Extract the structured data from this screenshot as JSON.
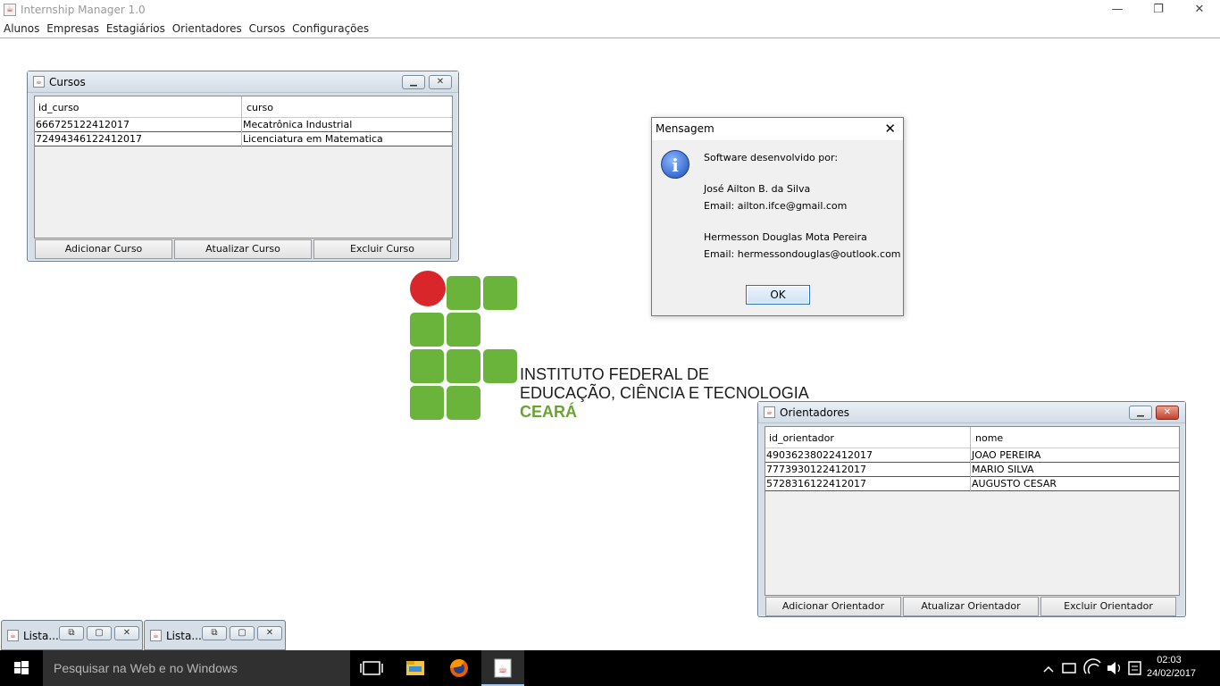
{
  "app": {
    "title": "Internship Manager 1.0"
  },
  "menu": [
    "Alunos",
    "Empresas",
    "Estagiários",
    "Orientadores",
    "Cursos",
    "Configurações"
  ],
  "cursos": {
    "title": "Cursos",
    "columns": [
      "id_curso",
      "curso"
    ],
    "rows": [
      [
        "666725122412017",
        "Mecatrônica Industrial"
      ],
      [
        "72494346122412017",
        "Licenciatura em Matematica"
      ]
    ],
    "buttons": [
      "Adicionar Curso",
      "Atualizar Curso",
      "Excluir Curso"
    ]
  },
  "orientadores": {
    "title": "Orientadores",
    "columns": [
      "id_orientador",
      "nome"
    ],
    "rows": [
      [
        "49036238022412017",
        "JOAO PEREIRA"
      ],
      [
        "7773930122412017",
        "MARIO SILVA"
      ],
      [
        "5728316122412017",
        "AUGUSTO CESAR"
      ]
    ],
    "buttons": [
      "Adicionar Orientador",
      "Atualizar Orientador",
      "Excluir Orientador"
    ]
  },
  "logo": {
    "line1": "INSTITUTO FEDERAL DE",
    "line2": "EDUCAÇÃO, CIÊNCIA E TECNOLOGIA",
    "line3": "CEARÁ",
    "colors": {
      "green": "#6ab43c",
      "red": "#d8262b"
    }
  },
  "dialog": {
    "title": "Mensagem",
    "lines": [
      "Software desenvolvido por:",
      "José Ailton B. da Silva",
      "Email: ailton.ifce@gmail.com",
      "Hermesson Douglas Mota Pereira",
      "Email: hermessondouglas@outlook.com"
    ],
    "ok": "OK"
  },
  "minimized": [
    {
      "label": "Lista..."
    },
    {
      "label": "Lista..."
    }
  ],
  "taskbar": {
    "search_placeholder": "Pesquisar na Web e no Windows",
    "time": "02:03",
    "date": "24/02/2017"
  }
}
